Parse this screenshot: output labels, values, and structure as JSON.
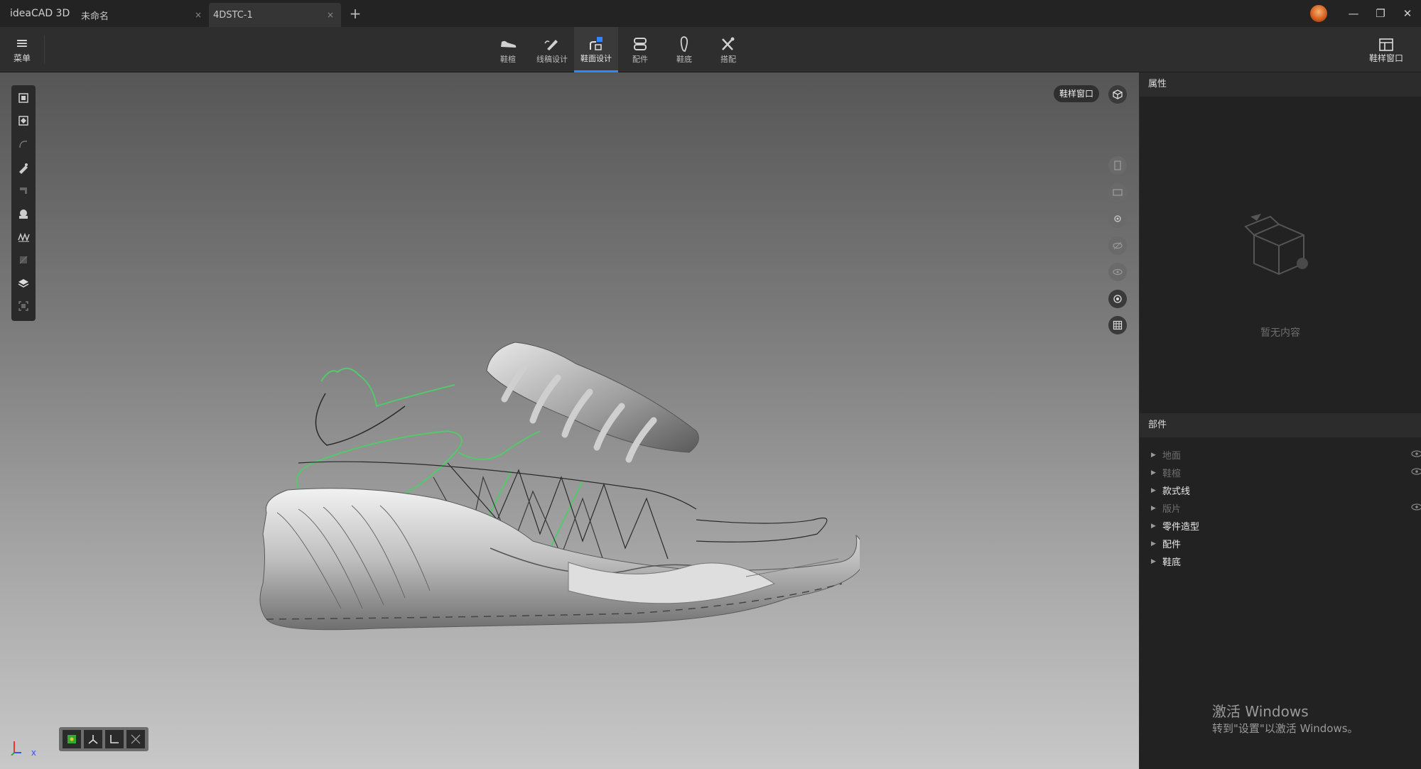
{
  "titlebar": {
    "app_title": "ideaCAD 3D",
    "tabs": [
      {
        "label": "未命名",
        "close": "×"
      },
      {
        "label": "4DSTC-1",
        "close": "×"
      }
    ],
    "add_tab": "+",
    "window_controls": {
      "minimize": "—",
      "restore": "❐",
      "close": "✕"
    }
  },
  "toolbar": {
    "menu_label": "菜单",
    "mode_tabs": [
      {
        "label": "鞋楦",
        "icon": "last-icon"
      },
      {
        "label": "线稿设计",
        "icon": "sketch-pen-icon"
      },
      {
        "label": "鞋面设计",
        "icon": "upper-design-icon",
        "active": true
      },
      {
        "label": "配件",
        "icon": "accessory-icon"
      },
      {
        "label": "鞋底",
        "icon": "sole-icon"
      },
      {
        "label": "搭配",
        "icon": "match-tools-icon"
      }
    ],
    "shoe_window_label": "鞋样窗口"
  },
  "viewport": {
    "label": "鞋样窗口",
    "axis_label": "x",
    "accent_green": "#52c96a",
    "active_blue": "#2f86ff"
  },
  "properties_panel": {
    "title": "属性",
    "empty_text": "暂无内容"
  },
  "parts_panel": {
    "title": "部件",
    "items": [
      {
        "label": "地面",
        "dim": true,
        "eye": true
      },
      {
        "label": "鞋楦",
        "dim": true,
        "eye": true
      },
      {
        "label": "款式线",
        "dim": false,
        "eye": false
      },
      {
        "label": "版片",
        "dim": true,
        "eye": true
      },
      {
        "label": "零件造型",
        "dim": false,
        "eye": false
      },
      {
        "label": "配件",
        "dim": false,
        "eye": false
      },
      {
        "label": "鞋底",
        "dim": false,
        "eye": false
      }
    ]
  },
  "watermark": {
    "line1": "激活 Windows",
    "line2": "转到\"设置\"以激活 Windows。"
  }
}
